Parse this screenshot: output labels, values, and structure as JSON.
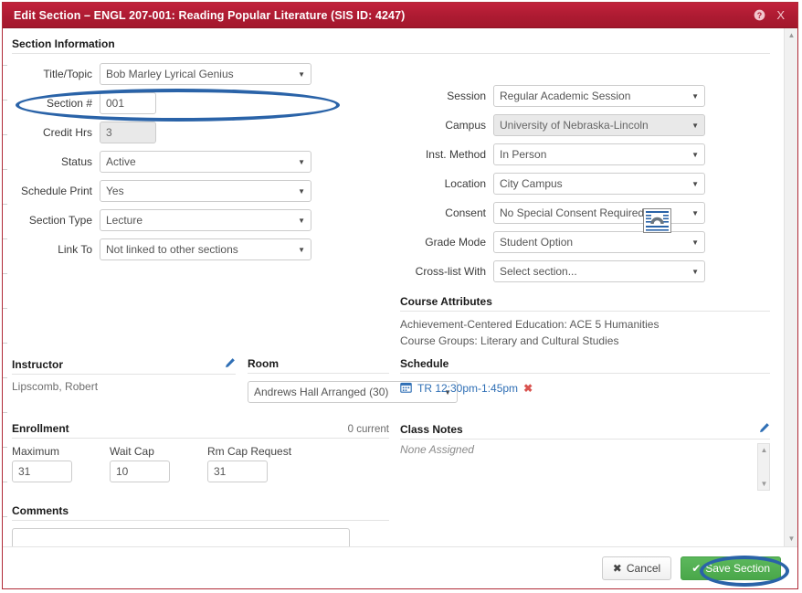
{
  "window": {
    "title": "Edit Section – ENGL 207-001: Reading Popular Literature (SIS ID: 4247)",
    "help_icon": "question-mark-icon",
    "close_icon": "close-icon",
    "close_label": "X"
  },
  "section_information": {
    "heading": "Section Information",
    "left_fields": [
      {
        "label": "Title/Topic",
        "value": "Bob Marley Lyrical Genius",
        "type": "select",
        "disabled": false,
        "width": "wide"
      },
      {
        "label": "Section #",
        "value": "001",
        "type": "text",
        "disabled": false,
        "width": "narrow"
      },
      {
        "label": "Credit Hrs",
        "value": "3",
        "type": "text",
        "disabled": true,
        "width": "narrow"
      },
      {
        "label": "Status",
        "value": "Active",
        "type": "select",
        "disabled": false,
        "width": "wide"
      },
      {
        "label": "Schedule Print",
        "value": "Yes",
        "type": "select",
        "disabled": false,
        "width": "wide"
      },
      {
        "label": "Section Type",
        "value": "Lecture",
        "type": "select",
        "disabled": false,
        "width": "wide"
      },
      {
        "label": "Link To",
        "value": "Not linked to other sections",
        "type": "select",
        "disabled": false,
        "width": "wide"
      }
    ],
    "right_fields": [
      {
        "label": "Session",
        "value": "Regular Academic Session",
        "type": "select",
        "disabled": false
      },
      {
        "label": "Campus",
        "value": "University of Nebraska-Lincoln",
        "type": "select",
        "disabled": true
      },
      {
        "label": "Inst. Method",
        "value": "In Person",
        "type": "select",
        "disabled": false
      },
      {
        "label": "Location",
        "value": "City Campus",
        "type": "select",
        "disabled": false
      },
      {
        "label": "Consent",
        "value": "No Special Consent Required",
        "type": "select",
        "disabled": false
      },
      {
        "label": "Grade Mode",
        "value": "Student Option",
        "type": "select",
        "disabled": false
      },
      {
        "label": "Cross-list With",
        "value": "Select section...",
        "type": "select",
        "disabled": false
      }
    ]
  },
  "course_attributes": {
    "heading": "Course Attributes",
    "lines": [
      "Achievement-Centered Education: ACE 5 Humanities",
      "Course Groups: Literary and Cultural Studies"
    ]
  },
  "instructor": {
    "heading": "Instructor",
    "edit_icon": "pencil-icon",
    "name": "Lipscomb, Robert"
  },
  "room": {
    "heading": "Room",
    "value": "Andrews Hall Arranged (30)"
  },
  "schedule": {
    "heading": "Schedule",
    "calendar_icon": "calendar-icon",
    "meeting": "TR 12:30pm-1:45pm",
    "delete_icon": "delete-x-icon",
    "delete_label": "✖"
  },
  "enrollment": {
    "heading": "Enrollment",
    "current": "0 current",
    "fields": [
      {
        "label": "Maximum",
        "value": "31"
      },
      {
        "label": "Wait Cap",
        "value": "10"
      },
      {
        "label": "Rm Cap Request",
        "value": "31"
      }
    ]
  },
  "class_notes": {
    "heading": "Class Notes",
    "edit_icon": "pencil-icon",
    "value": "None Assigned"
  },
  "comments": {
    "heading": "Comments",
    "value": "",
    "placeholder": ""
  },
  "footer": {
    "cancel_label": "Cancel",
    "cancel_icon": "x-icon",
    "cancel_glyph": "✖",
    "save_label": "Save Section",
    "save_icon": "check-icon",
    "save_glyph": "✔"
  },
  "annotations": {
    "highlight_title_topic": "blue-ellipse-around-title-topic",
    "highlight_save": "blue-ellipse-around-save-section",
    "overlay_icon": "text-cursor-overlay-icon"
  },
  "colors": {
    "header_red": "#ad1b32",
    "accent_blue": "#2a63a8",
    "save_green": "#5cb85c",
    "link_blue": "#2f6fb5",
    "delete_red": "#d9534f"
  },
  "scrollbars": {
    "up_arrow": "▲",
    "down_arrow": "▼"
  }
}
